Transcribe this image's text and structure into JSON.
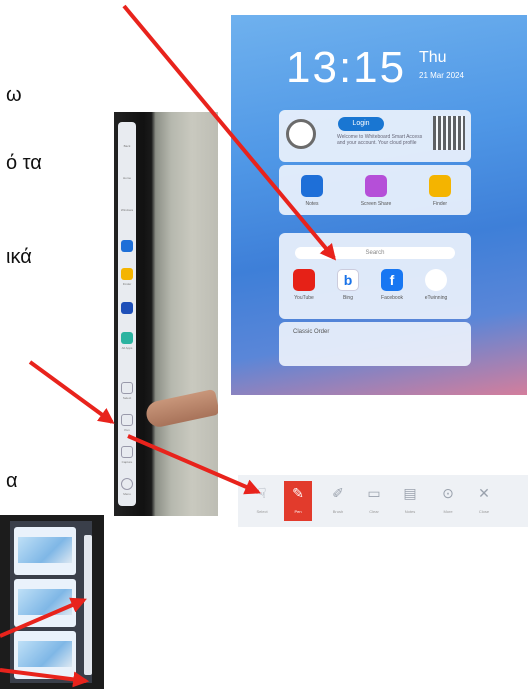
{
  "text_fragments": [
    "ω",
    "ό τα",
    "ικά",
    "α"
  ],
  "home": {
    "time": "13:15",
    "day": "Thu",
    "date": "21 Mar 2024",
    "login_label": "Login",
    "welcome_text": "Welcome to Whiteboard Smart Access and your account. Your cloud profile",
    "apps_row1": [
      {
        "label": "Notes",
        "icon": "pen-icon",
        "color": "#1e6fd8"
      },
      {
        "label": "Screen Share",
        "icon": "share-icon",
        "color": "#b54fd8"
      },
      {
        "label": "Finder",
        "icon": "folder-icon",
        "color": "#f4b400"
      }
    ],
    "search_placeholder": "Search",
    "apps_row2": [
      {
        "label": "YouTube",
        "icon": "youtube-icon",
        "color": "#e62117"
      },
      {
        "label": "Bing",
        "icon": "bing-icon",
        "color": "#ffffff"
      },
      {
        "label": "Facebook",
        "icon": "facebook-icon",
        "color": "#1877f2"
      },
      {
        "label": "eTwinning",
        "icon": "etwinning-icon",
        "color": "#ffffff"
      }
    ],
    "board_label": "Classic Order"
  },
  "sidebar": {
    "items": [
      {
        "label": "Back",
        "icon": "chevron-left-icon",
        "color": "#e8ebf0"
      },
      {
        "label": "Home",
        "icon": "home-icon",
        "color": "#e8ebf0"
      },
      {
        "label": "Windows",
        "icon": "windows-icon",
        "color": "#e8ebf0"
      },
      {
        "label": "",
        "icon": "app-blue-icon",
        "color": "#1e6fd8"
      },
      {
        "label": "Finder",
        "icon": "folder-icon",
        "color": "#f4b400"
      },
      {
        "label": "Browser",
        "icon": "browser-icon",
        "color": "#1e4fb8"
      },
      {
        "label": "All Apps",
        "icon": "grid-icon",
        "color": "#2bb3a0"
      },
      {
        "label": "Select",
        "icon": "select-icon",
        "color": "#e8ebf0"
      },
      {
        "label": "Pen",
        "icon": "pen-icon",
        "color": "#e8ebf0"
      },
      {
        "label": "Capture",
        "icon": "capture-icon",
        "color": "#e8ebf0"
      },
      {
        "label": "Menu",
        "icon": "menu-icon",
        "color": "#e8ebf0"
      }
    ]
  },
  "toolbar": {
    "items": [
      {
        "label": "Select",
        "icon": "select-icon",
        "glyph": "☟",
        "active": false
      },
      {
        "label": "Pen",
        "icon": "pen-icon",
        "glyph": "✎",
        "active": true
      },
      {
        "label": "Brush",
        "icon": "brush-icon",
        "glyph": "✐",
        "active": false
      },
      {
        "label": "Clear",
        "icon": "eraser-icon",
        "glyph": "▭",
        "active": false
      },
      {
        "label": "Notes",
        "icon": "notes-icon",
        "glyph": "▤",
        "active": false
      },
      {
        "label": "More",
        "icon": "more-icon",
        "glyph": "⊙",
        "active": false
      },
      {
        "label": "Close",
        "icon": "close-icon",
        "glyph": "✕",
        "active": false
      }
    ]
  },
  "accent_colors": {
    "arrow": "#e8231c",
    "pen_active": "#e23b2c",
    "login": "#1976d2"
  }
}
